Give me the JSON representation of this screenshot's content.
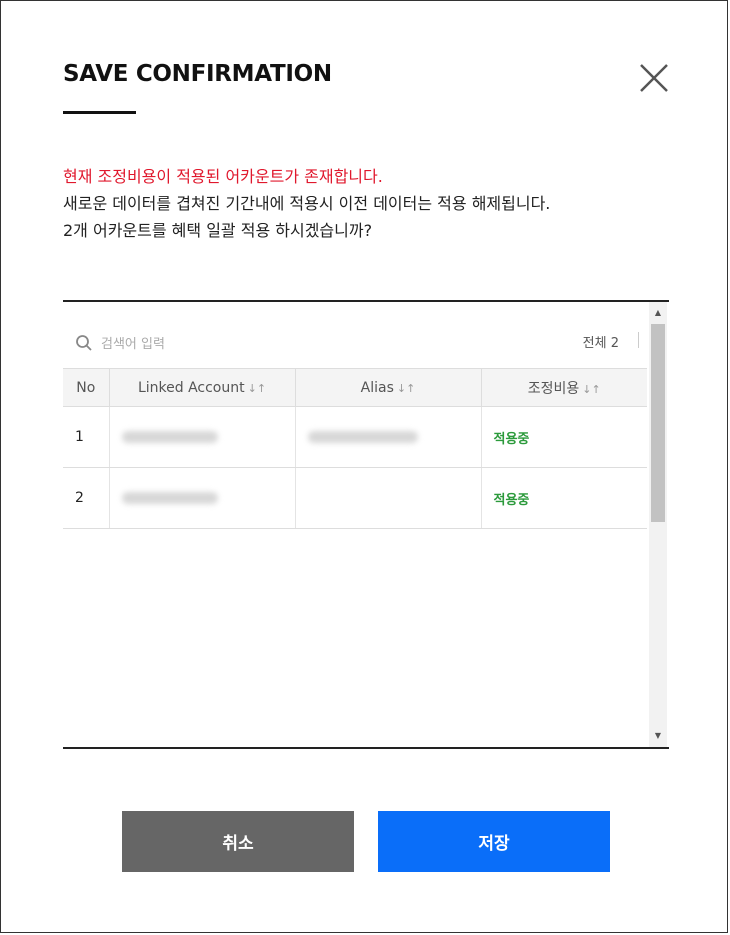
{
  "dialog": {
    "title": "SAVE CONFIRMATION",
    "messages": {
      "warning": "현재 조정비용이 적용된 어카운트가 존재합니다.",
      "line2": "새로운 데이터를 겹쳐진 기간내에 적용시 이전 데이터는 적용 해제됩니다.",
      "line3": "2개 어카운트를 혜택 일괄 적용 하시겠습니까?"
    }
  },
  "search": {
    "placeholder": "검색어 입력",
    "value": ""
  },
  "total_label": "전체 2",
  "table": {
    "columns": [
      {
        "label": "No",
        "sortable": false
      },
      {
        "label": "Linked Account",
        "sortable": true
      },
      {
        "label": "Alias",
        "sortable": true
      },
      {
        "label": "조정비용",
        "sortable": true
      }
    ],
    "sort_arrows": "↓↑",
    "rows": [
      {
        "no": "1",
        "status": "적용중"
      },
      {
        "no": "2",
        "status": "적용중"
      }
    ]
  },
  "buttons": {
    "cancel": "취소",
    "save": "저장"
  },
  "colors": {
    "warning": "#e0182d",
    "status_applied": "#2b9a3b",
    "save_button": "#0a6ef9",
    "cancel_button": "#666666"
  },
  "icons": {
    "close": "close-icon",
    "search": "search-icon"
  }
}
